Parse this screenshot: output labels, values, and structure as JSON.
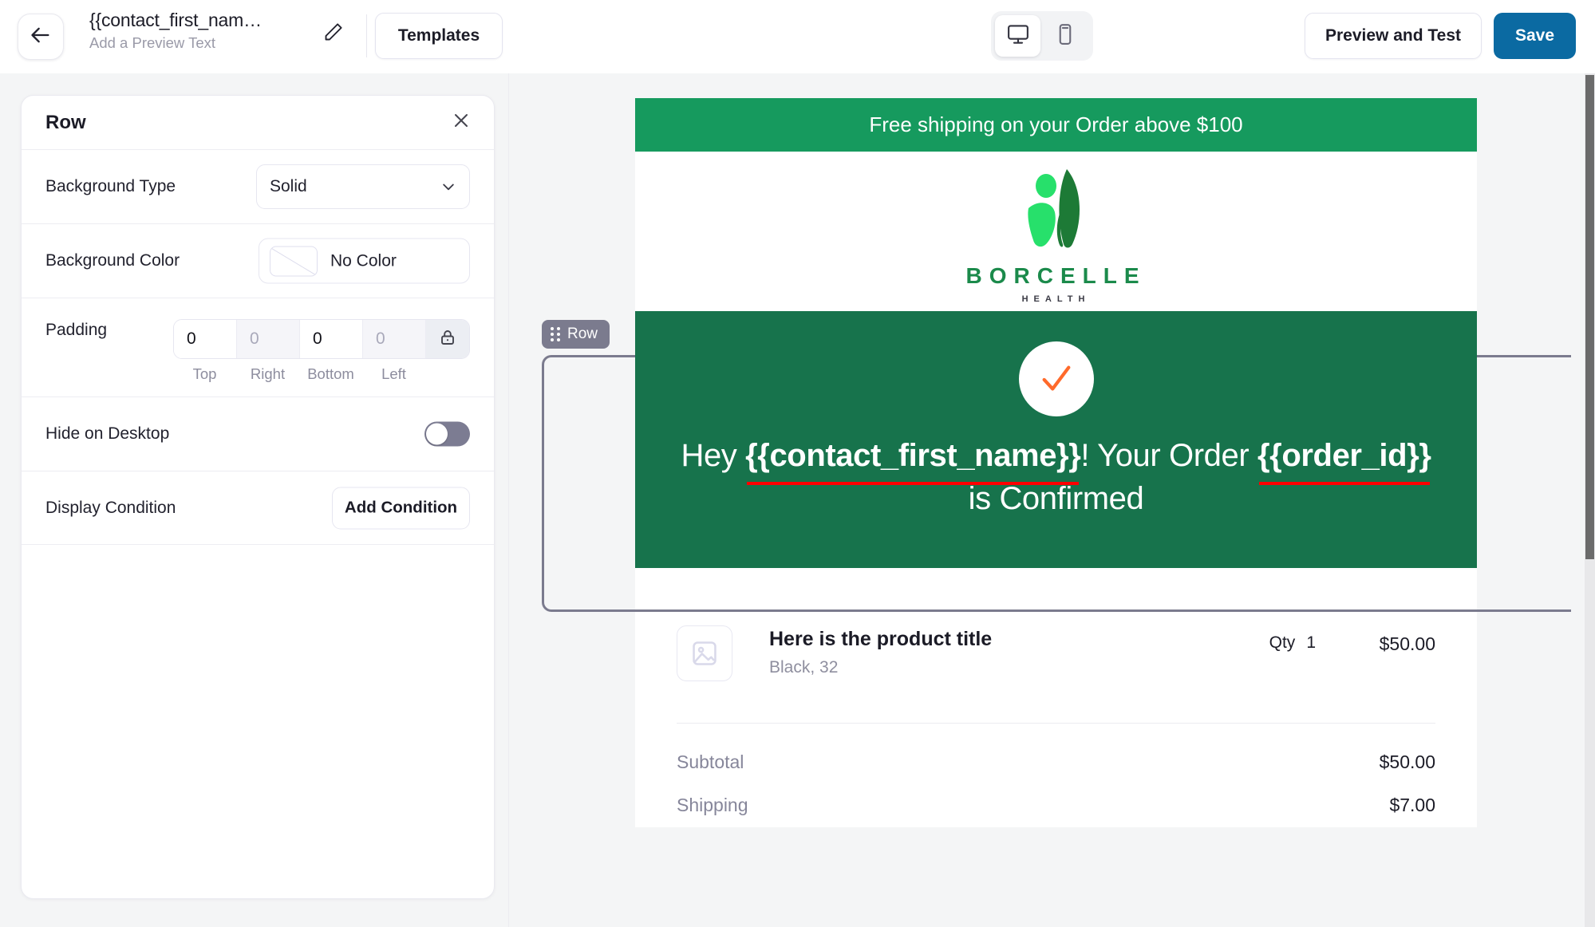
{
  "header": {
    "back_icon": "arrow-left-icon",
    "title": "{{contact_first_nam…",
    "subtitle": "Add a Preview Text",
    "edit_icon": "pencil-icon",
    "templates_label": "Templates",
    "desktop_icon": "monitor-icon",
    "mobile_icon": "phone-icon",
    "preview_label": "Preview and Test",
    "save_label": "Save",
    "save_color": "#0b6aa2"
  },
  "panel": {
    "title": "Row",
    "close_icon": "close-icon",
    "background_type": {
      "label": "Background Type",
      "value": "Solid",
      "chevron_icon": "chevron-down-icon"
    },
    "background_color": {
      "label": "Background Color",
      "value": "No Color",
      "swatch": "no-color-swatch"
    },
    "padding": {
      "label": "Padding",
      "values": [
        "0",
        "0",
        "0",
        "0"
      ],
      "active": [
        true,
        false,
        true,
        false
      ],
      "sides": [
        "Top",
        "Right",
        "Bottom",
        "Left"
      ],
      "lock_icon": "lock-icon"
    },
    "hide_on_desktop": {
      "label": "Hide on Desktop",
      "enabled": false
    },
    "display_condition": {
      "label": "Display Condition",
      "button_label": "Add Condition"
    }
  },
  "email": {
    "shipping_banner": "Free shipping on your Order above $100",
    "banner_color": "#169a5e",
    "logo": {
      "wordmark": "BORCELLE",
      "tagline": "HEALTH",
      "mark_icon": "leaf-person-logo-icon",
      "color": "#1b8a4b"
    },
    "selected_row_badge": "Row",
    "confirmation": {
      "bg_color": "#17734c",
      "check_icon": "check-circle-icon",
      "check_color": "#ff6a2b",
      "line1_a": "Hey ",
      "line1_merge": "{{contact_first_name}}",
      "line1_b": "! Your Order",
      "line2_merge": "{{order_id}}",
      "line2_b": " is Confirmed",
      "underline_color": "#ff0000"
    },
    "product": {
      "thumb_icon": "image-placeholder-icon",
      "title": "Here is the product title",
      "variant": "Black, 32",
      "qty_label": "Qty",
      "qty_value": "1",
      "price": "$50.00"
    },
    "totals": [
      {
        "label": "Subtotal",
        "value": "$50.00"
      },
      {
        "label": "Shipping",
        "value": "$7.00"
      }
    ]
  }
}
